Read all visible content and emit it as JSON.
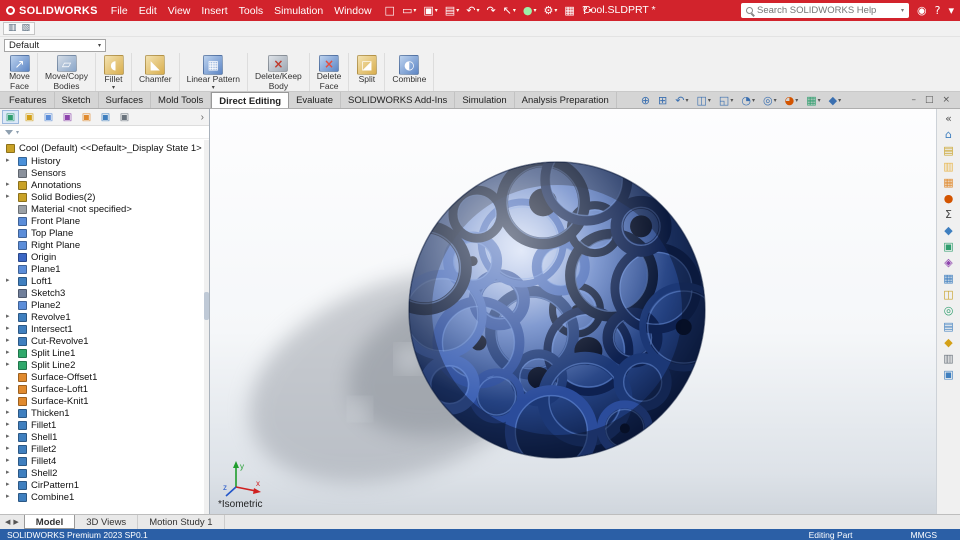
{
  "titlebar": {
    "brand": "SOLIDWORKS",
    "menus": [
      "File",
      "Edit",
      "View",
      "Insert",
      "Tools",
      "Simulation",
      "Window"
    ],
    "toolbar_icons": [
      {
        "name": "new-file-icon"
      },
      {
        "name": "open-file-icon",
        "caret": true
      },
      {
        "name": "save-icon",
        "caret": true
      },
      {
        "name": "print-icon",
        "caret": true
      },
      {
        "name": "undo-icon",
        "caret": true
      },
      {
        "name": "redo-icon"
      },
      {
        "name": "select-icon",
        "caret": true
      },
      {
        "name": "rebuild-icon",
        "caret": true
      },
      {
        "name": "options-icon",
        "caret": true
      },
      {
        "name": "file-properties-icon"
      },
      {
        "name": "help-icon",
        "caret": true
      }
    ],
    "doc_title": "Cool.SLDPRT *",
    "search_placeholder": "Search SOLIDWORKS Help",
    "right_icons": [
      {
        "name": "login-icon"
      },
      {
        "name": "help-menu-icon"
      },
      {
        "name": "window-menu-icon"
      }
    ]
  },
  "quick_toolbar_icons": [
    {
      "name": "show-feature-tree-icon"
    },
    {
      "name": "show-display-pane-icon"
    }
  ],
  "configuration": {
    "value": "Default"
  },
  "ribbon": {
    "buttons": [
      {
        "lines": [
          "Move",
          "Face"
        ],
        "icon": "move-face"
      },
      {
        "lines": [
          "Move/Copy",
          "Bodies"
        ],
        "icon": "move-copy-bodies"
      },
      {
        "lines": [
          "Fillet"
        ],
        "icon": "fillet",
        "caret": true
      },
      {
        "lines": [
          "Chamfer"
        ],
        "icon": "chamfer"
      },
      {
        "lines": [
          "Linear Pattern"
        ],
        "icon": "linear-pattern",
        "caret": true
      },
      {
        "lines": [
          "Delete/Keep",
          "Body"
        ],
        "icon": "delete-keep-body"
      },
      {
        "lines": [
          "Delete",
          "Face"
        ],
        "icon": "delete-face"
      },
      {
        "lines": [
          "Split"
        ],
        "icon": "split"
      },
      {
        "lines": [
          "Combine"
        ],
        "icon": "combine"
      }
    ]
  },
  "command_tabs": [
    {
      "label": "Features"
    },
    {
      "label": "Sketch"
    },
    {
      "label": "Surfaces"
    },
    {
      "label": "Mold Tools"
    },
    {
      "label": "Direct Editing",
      "active": true
    },
    {
      "label": "Evaluate"
    },
    {
      "label": "SOLIDWORKS Add-Ins"
    },
    {
      "label": "Simulation"
    },
    {
      "label": "Analysis Preparation"
    }
  ],
  "headsup_icons": [
    {
      "name": "zoom-fit-icon"
    },
    {
      "name": "zoom-area-icon"
    },
    {
      "name": "previous-view-icon",
      "caret": true
    },
    {
      "name": "section-view-icon",
      "caret": true
    },
    {
      "name": "view-orientation-icon",
      "caret": true
    },
    {
      "name": "display-style-icon",
      "caret": true
    },
    {
      "name": "hide-show-items-icon",
      "caret": true
    },
    {
      "name": "edit-appearance-icon",
      "caret": true
    },
    {
      "name": "apply-scene-icon",
      "caret": true
    },
    {
      "name": "view-settings-icon",
      "caret": true
    }
  ],
  "window_controls": [
    {
      "name": "minimize-document-icon"
    },
    {
      "name": "restore-document-icon"
    },
    {
      "name": "close-document-icon"
    }
  ],
  "left_panel": {
    "tabs": [
      {
        "name": "featuremanager-tab"
      },
      {
        "name": "propertymanager-tab"
      },
      {
        "name": "configurationmanager-tab"
      },
      {
        "name": "dimxpertmanager-tab"
      },
      {
        "name": "displaymanager-tab"
      },
      {
        "name": "cam-feature-tab"
      },
      {
        "name": "cam-operation-tab"
      }
    ]
  },
  "feature_tree": {
    "root": "Cool (Default) <<Default>_Display State 1>",
    "items": [
      {
        "label": "History",
        "icon": "history-icon",
        "arrow": true
      },
      {
        "label": "Sensors",
        "icon": "sensors-icon",
        "arrow": false
      },
      {
        "label": "Annotations",
        "icon": "annotations-icon",
        "arrow": true
      },
      {
        "label": "Solid Bodies(2)",
        "icon": "solid-bodies-folder-icon",
        "arrow": true
      },
      {
        "label": "Material <not specified>",
        "icon": "material-icon",
        "arrow": false
      },
      {
        "label": "Front Plane",
        "icon": "plane-icon",
        "arrow": false
      },
      {
        "label": "Top Plane",
        "icon": "plane-icon",
        "arrow": false
      },
      {
        "label": "Right Plane",
        "icon": "plane-icon",
        "arrow": false
      },
      {
        "label": "Origin",
        "icon": "origin-icon",
        "arrow": false
      },
      {
        "label": "Plane1",
        "icon": "plane-icon",
        "arrow": false
      },
      {
        "label": "Loft1",
        "icon": "loft-icon",
        "arrow": true
      },
      {
        "label": "Sketch3",
        "icon": "sketch-icon",
        "arrow": false
      },
      {
        "label": "Plane2",
        "icon": "plane-icon",
        "arrow": false
      },
      {
        "label": "Revolve1",
        "icon": "revolve-icon",
        "arrow": true
      },
      {
        "label": "Intersect1",
        "icon": "intersect-icon",
        "arrow": true
      },
      {
        "label": "Cut-Revolve1",
        "icon": "cut-revolve-icon",
        "arrow": true
      },
      {
        "label": "Split Line1",
        "icon": "split-line-icon",
        "arrow": true
      },
      {
        "label": "Split Line2",
        "icon": "split-line-icon",
        "arrow": true
      },
      {
        "label": "Surface-Offset1",
        "icon": "surface-offset-icon",
        "arrow": false
      },
      {
        "label": "Surface-Loft1",
        "icon": "surface-loft-icon",
        "arrow": true
      },
      {
        "label": "Surface-Knit1",
        "icon": "surface-knit-icon",
        "arrow": true
      },
      {
        "label": "Thicken1",
        "icon": "thicken-icon",
        "arrow": true
      },
      {
        "label": "Fillet1",
        "icon": "fillet-icon",
        "arrow": true
      },
      {
        "label": "Shell1",
        "icon": "shell-icon",
        "arrow": true
      },
      {
        "label": "Fillet2",
        "icon": "fillet-icon",
        "arrow": true
      },
      {
        "label": "Fillet4",
        "icon": "fillet-icon",
        "arrow": true
      },
      {
        "label": "Shell2",
        "icon": "shell-icon",
        "arrow": true
      },
      {
        "label": "CirPattern1",
        "icon": "cirpattern-icon",
        "arrow": true
      },
      {
        "label": "Combine1",
        "icon": "combine-icon",
        "arrow": true
      }
    ]
  },
  "viewport": {
    "view_label": "*Isometric",
    "triad": {
      "x": "x",
      "y": "y",
      "z": "z"
    }
  },
  "taskpane_icons": [
    {
      "name": "collapse-taskpane-icon"
    },
    {
      "name": "solidworks-resources-icon"
    },
    {
      "name": "design-library-icon"
    },
    {
      "name": "file-explorer-icon"
    },
    {
      "name": "view-palette-icon"
    },
    {
      "name": "appearances-scenes-icon"
    },
    {
      "name": "custom-properties-icon"
    },
    {
      "name": "solidworks-forum-icon"
    },
    {
      "name": "subscription-services-icon"
    },
    {
      "name": "measure-icon"
    },
    {
      "name": "mass-properties-icon"
    },
    {
      "name": "section-properties-icon"
    },
    {
      "name": "performance-evaluation-icon"
    },
    {
      "name": "import-diagnostics-icon"
    },
    {
      "name": "deviation-analysis-icon"
    },
    {
      "name": "symmetry-check-icon"
    },
    {
      "name": "compare-icon"
    }
  ],
  "bottom_tabs": [
    {
      "label": "Model",
      "active": true
    },
    {
      "label": "3D Views"
    },
    {
      "label": "Motion Study 1"
    }
  ],
  "statusbar": {
    "left": "SOLIDWORKS Premium 2023 SP0.1",
    "mode": "Editing Part",
    "units": "MMGS"
  },
  "colors": {
    "titlebar_red": "#d2232c",
    "statusbar_blue": "#2b5fa6",
    "model_blue": "#23407f"
  }
}
